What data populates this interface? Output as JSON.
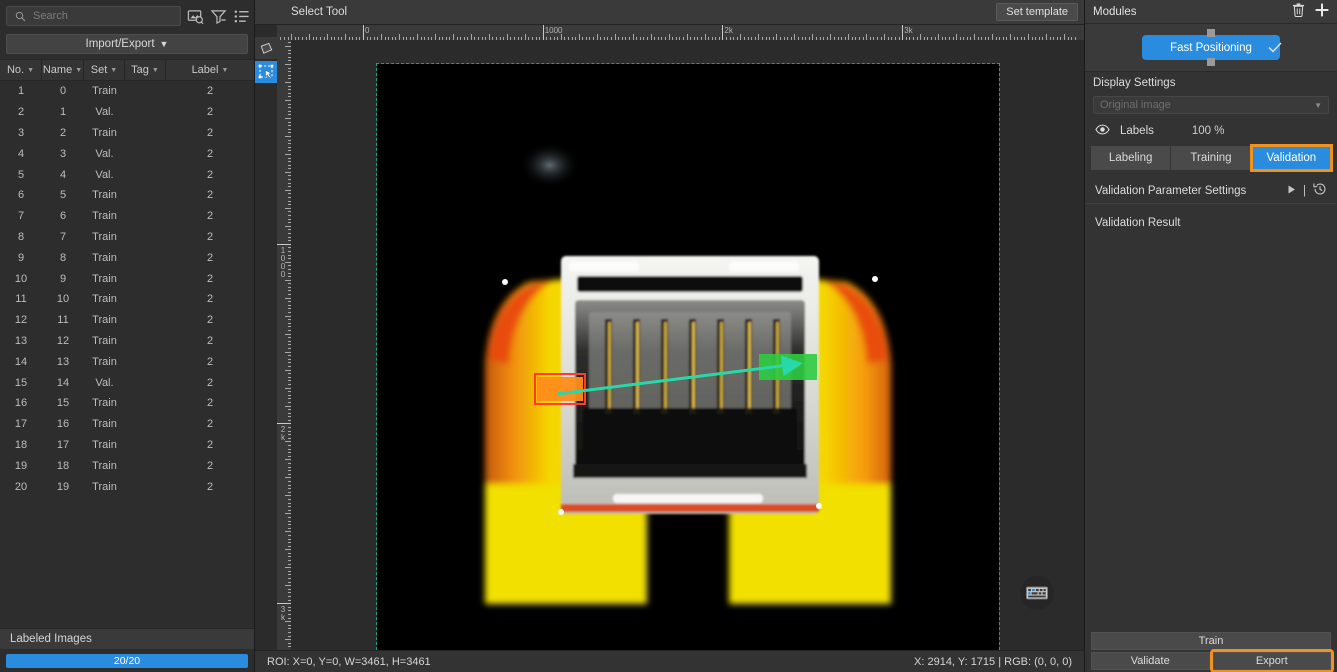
{
  "left": {
    "search": {
      "placeholder": "Search",
      "value": ""
    },
    "icons": [
      "image-search-icon",
      "filter-icon",
      "list-view-icon",
      "panel-layout-icon"
    ],
    "import_export_label": "Import/Export",
    "columns": [
      {
        "key": "no",
        "label": "No."
      },
      {
        "key": "name",
        "label": "Name"
      },
      {
        "key": "set",
        "label": "Set"
      },
      {
        "key": "tag",
        "label": "Tag"
      },
      {
        "key": "label",
        "label": "Label"
      }
    ],
    "rows": [
      {
        "no": "1",
        "name": "0",
        "set": "Train",
        "tag": "",
        "label": "2"
      },
      {
        "no": "2",
        "name": "1",
        "set": "Val.",
        "tag": "",
        "label": "2"
      },
      {
        "no": "3",
        "name": "2",
        "set": "Train",
        "tag": "",
        "label": "2"
      },
      {
        "no": "4",
        "name": "3",
        "set": "Val.",
        "tag": "",
        "label": "2"
      },
      {
        "no": "5",
        "name": "4",
        "set": "Val.",
        "tag": "",
        "label": "2"
      },
      {
        "no": "6",
        "name": "5",
        "set": "Train",
        "tag": "",
        "label": "2"
      },
      {
        "no": "7",
        "name": "6",
        "set": "Train",
        "tag": "",
        "label": "2"
      },
      {
        "no": "8",
        "name": "7",
        "set": "Train",
        "tag": "",
        "label": "2"
      },
      {
        "no": "9",
        "name": "8",
        "set": "Train",
        "tag": "",
        "label": "2"
      },
      {
        "no": "10",
        "name": "9",
        "set": "Train",
        "tag": "",
        "label": "2"
      },
      {
        "no": "11",
        "name": "10",
        "set": "Train",
        "tag": "",
        "label": "2"
      },
      {
        "no": "12",
        "name": "11",
        "set": "Train",
        "tag": "",
        "label": "2"
      },
      {
        "no": "13",
        "name": "12",
        "set": "Train",
        "tag": "",
        "label": "2"
      },
      {
        "no": "14",
        "name": "13",
        "set": "Train",
        "tag": "",
        "label": "2"
      },
      {
        "no": "15",
        "name": "14",
        "set": "Val.",
        "tag": "",
        "label": "2"
      },
      {
        "no": "16",
        "name": "15",
        "set": "Train",
        "tag": "",
        "label": "2"
      },
      {
        "no": "17",
        "name": "16",
        "set": "Train",
        "tag": "",
        "label": "2"
      },
      {
        "no": "18",
        "name": "17",
        "set": "Train",
        "tag": "",
        "label": "2"
      },
      {
        "no": "19",
        "name": "18",
        "set": "Train",
        "tag": "",
        "label": "2"
      },
      {
        "no": "20",
        "name": "19",
        "set": "Train",
        "tag": "",
        "label": "2"
      }
    ],
    "labeled_images_label": "Labeled Images",
    "progress_text": "20/20",
    "progress_color": "#2a8cdf"
  },
  "center": {
    "toolbar_title": "Select Tool",
    "set_template_label": "Set template",
    "tools": [
      {
        "name": "shape-tool",
        "active": false
      },
      {
        "name": "select-tool",
        "active": true
      }
    ],
    "ruler_h_labels": [
      "0",
      "1000",
      "2k",
      "3k"
    ],
    "ruler_v_labels": [
      "1000",
      "2k",
      "3k"
    ],
    "status_left": "ROI: X=0, Y=0, W=3461, H=3461",
    "status_right": "X: 2914, Y: 1715 | RGB: (0, 0, 0)",
    "keyboard_button": "keyboard-shortcuts-icon",
    "annotations": {
      "roi_box_color": "#ff7a18",
      "target_box_color": "#2ecc40",
      "arrow_color": "#27d8a8",
      "selection_color": "#16a085"
    }
  },
  "right": {
    "header_title": "Modules",
    "header_actions": [
      "delete-icon",
      "add-icon"
    ],
    "module_node": {
      "label": "Fast Positioning",
      "color": "#2a8cdf",
      "check": "check-icon"
    },
    "display_settings_title": "Display Settings",
    "image_select": {
      "value": "Original image",
      "disabled": true
    },
    "labels_row": {
      "eye": "eye-icon",
      "label": "Labels",
      "percent": "100 %"
    },
    "tabs": [
      {
        "label": "Labeling",
        "active": false
      },
      {
        "label": "Training",
        "active": false
      },
      {
        "label": "Validation",
        "active": true
      }
    ],
    "highlight_color": "#f0931e",
    "param_row": {
      "label": "Validation Parameter Settings",
      "expand": "play-arrow-icon",
      "reset": "history-reset-icon"
    },
    "result_row": {
      "label": "Validation Result"
    },
    "buttons": {
      "train": "Train",
      "validate": "Validate",
      "export": "Export"
    }
  }
}
